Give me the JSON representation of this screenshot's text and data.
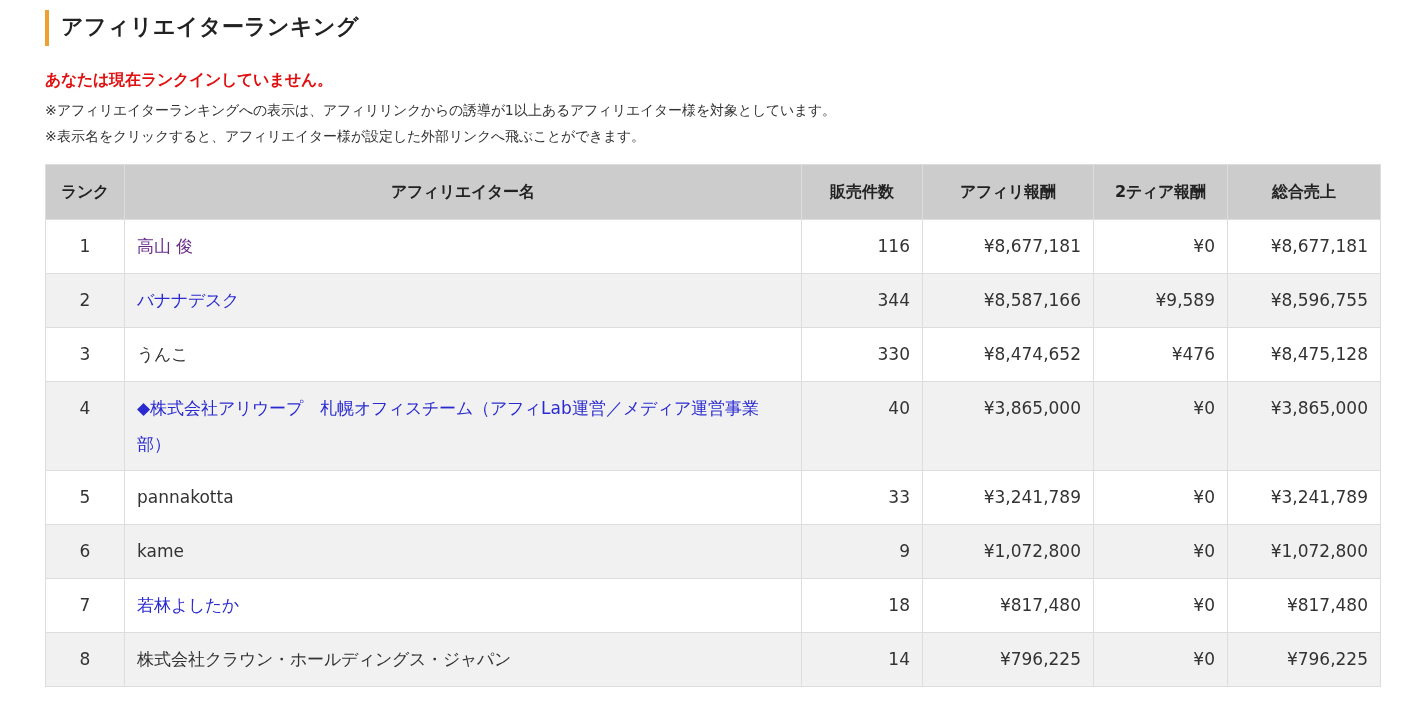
{
  "title": "アフィリエイターランキング",
  "notice": "あなたは現在ランクインしていません。",
  "notes": [
    "※アフィリエイターランキングへの表示は、アフィリリンクからの誘導が1以上あるアフィリエイター様を対象としています。",
    "※表示名をクリックすると、アフィリエイター様が設定した外部リンクへ飛ぶことができます。"
  ],
  "table": {
    "columns": [
      "ランク",
      "アフィリエイター名",
      "販売件数",
      "アフィリ報酬",
      "2ティア報酬",
      "総合売上"
    ],
    "rows": [
      {
        "rank": "1",
        "name": "高山 俊",
        "kind": "visited_link",
        "sales": "116",
        "affiliate": "¥8,677,181",
        "tier2": "¥0",
        "total": "¥8,677,181"
      },
      {
        "rank": "2",
        "name": "バナナデスク",
        "kind": "link",
        "sales": "344",
        "affiliate": "¥8,587,166",
        "tier2": "¥9,589",
        "total": "¥8,596,755"
      },
      {
        "rank": "3",
        "name": "うんこ",
        "kind": "text",
        "sales": "330",
        "affiliate": "¥8,474,652",
        "tier2": "¥476",
        "total": "¥8,475,128"
      },
      {
        "rank": "4",
        "name": "◆株式会社アリウープ　札幌オフィスチーム（アフィLab運営／メディア運営事業部）",
        "kind": "link",
        "sales": "40",
        "affiliate": "¥3,865,000",
        "tier2": "¥0",
        "total": "¥3,865,000"
      },
      {
        "rank": "5",
        "name": "pannakotta",
        "kind": "text",
        "sales": "33",
        "affiliate": "¥3,241,789",
        "tier2": "¥0",
        "total": "¥3,241,789"
      },
      {
        "rank": "6",
        "name": "kame",
        "kind": "text",
        "sales": "9",
        "affiliate": "¥1,072,800",
        "tier2": "¥0",
        "total": "¥1,072,800"
      },
      {
        "rank": "7",
        "name": "若林よしたか",
        "kind": "link",
        "sales": "18",
        "affiliate": "¥817,480",
        "tier2": "¥0",
        "total": "¥817,480"
      },
      {
        "rank": "8",
        "name": "株式会社クラウン・ホールディングス・ジャパン",
        "kind": "text",
        "sales": "14",
        "affiliate": "¥796,225",
        "tier2": "¥0",
        "total": "¥796,225"
      }
    ]
  }
}
